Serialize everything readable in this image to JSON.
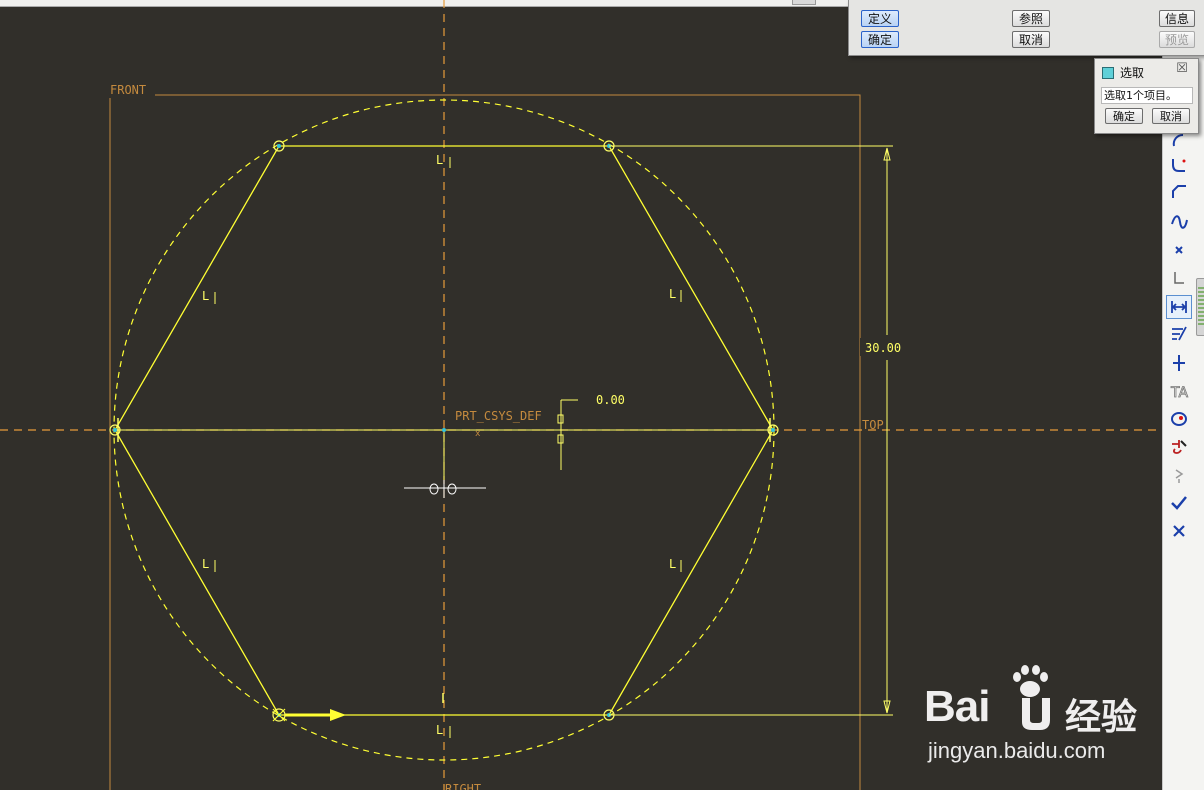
{
  "colors": {
    "background": "#312f2a",
    "sketch": "#ffff33",
    "datum": "#e69b3a",
    "vertex": "#33c2d8"
  },
  "sketch": {
    "datum_front": "FRONT",
    "datum_top": "TOP",
    "datum_right": "RIGHT",
    "csys_label": "PRT_CSYS_DEF",
    "dimension_30": "30.00",
    "dimension_zero": "0.00",
    "constraint_symbol": "L"
  },
  "menu_manager": {
    "define": "定义",
    "confirm": "确定",
    "references": "参照",
    "cancel": "取消",
    "info": "信息",
    "preview": "预览"
  },
  "select_dialog": {
    "title": "选取",
    "close_glyph": "☒",
    "message": "选取1个项目。",
    "ok": "确定",
    "cancel": "取消"
  },
  "toolbar": {
    "tools": [
      {
        "name": "arc-tool-icon"
      },
      {
        "name": "fillet-tool-icon"
      },
      {
        "name": "chamfer-tool-icon"
      },
      {
        "name": "spline-tool-icon"
      },
      {
        "name": "point-tool-icon"
      },
      {
        "name": "coordinate-system-icon"
      },
      {
        "name": "dimension-tool-icon",
        "active": true
      },
      {
        "name": "modify-tool-icon"
      },
      {
        "name": "constraint-tool-icon"
      },
      {
        "name": "text-tool-icon"
      },
      {
        "name": "palette-tool-icon"
      },
      {
        "name": "trim-tool-icon"
      },
      {
        "name": "mirror-tool-icon"
      },
      {
        "name": "accept-icon"
      },
      {
        "name": "cancel-icon"
      }
    ]
  },
  "watermark": {
    "brand": "Bai",
    "brand_cn": "经验",
    "url": "jingyan.baidu.com"
  }
}
